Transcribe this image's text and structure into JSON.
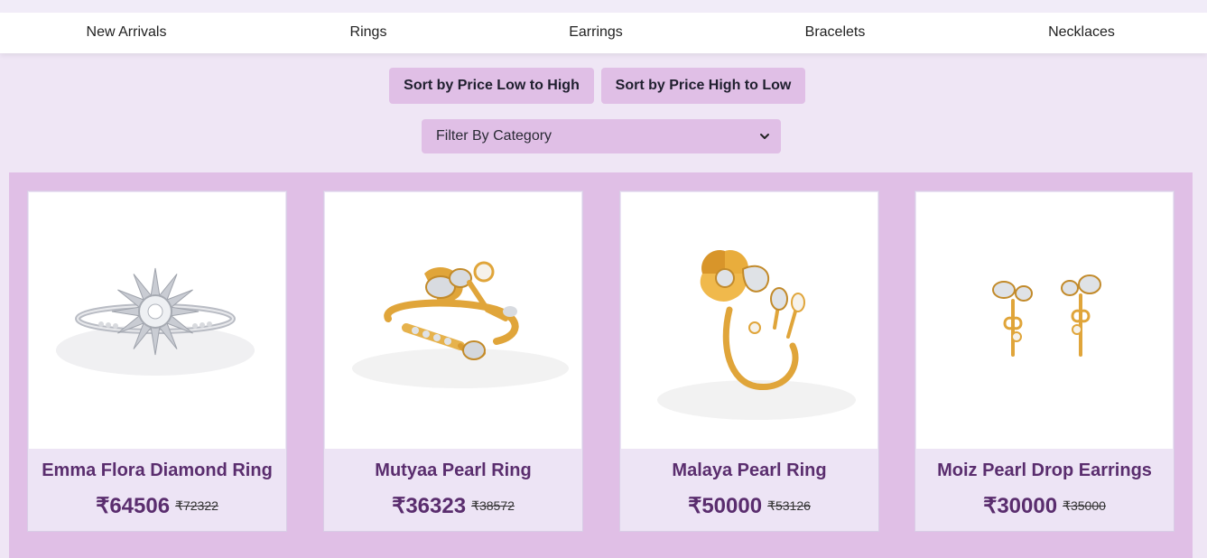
{
  "nav": {
    "items": [
      {
        "label": "New Arrivals"
      },
      {
        "label": "Rings"
      },
      {
        "label": "Earrings"
      },
      {
        "label": "Bracelets"
      },
      {
        "label": "Necklaces"
      }
    ]
  },
  "controls": {
    "sort_low_high": "Sort by Price Low to High",
    "sort_high_low": "Sort by Price High to Low",
    "filter_label": "Filter By Category"
  },
  "products": [
    {
      "name": "Emma Flora Diamond Ring",
      "price": "₹64506",
      "old_price": "₹72322",
      "image_icon": "silver-diamond-ring"
    },
    {
      "name": "Mutyaa Pearl Ring",
      "price": "₹36323",
      "old_price": "₹38572",
      "image_icon": "gold-pearl-ring"
    },
    {
      "name": "Malaya Pearl Ring",
      "price": "₹50000",
      "old_price": "₹53126",
      "image_icon": "gold-flower-ring"
    },
    {
      "name": "Moiz Pearl Drop Earrings",
      "price": "₹30000",
      "old_price": "₹35000",
      "image_icon": "gold-pearl-earrings"
    }
  ],
  "colors": {
    "accent": "#e0bfe6",
    "page_bg": "#efe6f5",
    "title": "#5a2d6e",
    "gold": "#e0a53a"
  }
}
